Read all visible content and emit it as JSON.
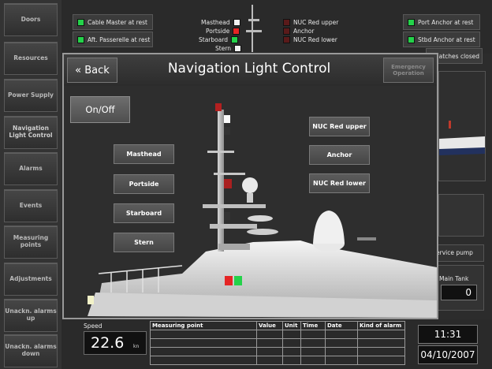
{
  "sidebar": {
    "items": [
      {
        "label": "Doors"
      },
      {
        "label": "Resources"
      },
      {
        "label": "Power Supply"
      },
      {
        "label": "Navigation Light Control"
      },
      {
        "label": "Alarms"
      },
      {
        "label": "Events"
      },
      {
        "label": "Measuring points"
      },
      {
        "label": "Adjustments"
      },
      {
        "label": "Unackn. alarms up"
      },
      {
        "label": "Unackn. alarms down"
      }
    ]
  },
  "status": {
    "cable_master": "Cable Master at rest",
    "aft_passerelle": "Aft. Passerelle at rest",
    "port_anchor": "Port Anchor at rest",
    "stbd_anchor": "Stbd Anchor at rest",
    "hatches": "Hatches closed",
    "lights": [
      {
        "label": "Masthead",
        "color": "#f2f2f2"
      },
      {
        "label": "Portside",
        "color": "#e52525"
      },
      {
        "label": "Starboard",
        "color": "#24d24a"
      },
      {
        "label": "Stern",
        "color": "#f2f2f2"
      }
    ],
    "nuc_lights": [
      {
        "label": "NUC Red upper"
      },
      {
        "label": "Anchor"
      },
      {
        "label": "NUC Red lower"
      }
    ]
  },
  "right_panel": {
    "service_pump": "ervice pump",
    "main_tank_label": "Main Tank",
    "main_tank_value": "0"
  },
  "modal": {
    "back_label": "« Back",
    "title": "Navigation Light Control",
    "emergency_label": "Emergency Operation",
    "onoff_label": "On/Off",
    "left_buttons": [
      "Masthead",
      "Portside",
      "Starboard",
      "Stern"
    ],
    "right_buttons": [
      "NUC Red upper",
      "Anchor",
      "NUC Red lower"
    ]
  },
  "bottom": {
    "speed_label": "Speed",
    "speed_value": "22.6",
    "speed_unit": "kn",
    "table_headers": [
      "Measuring point",
      "Value",
      "Unit",
      "Time",
      "Date",
      "Kind of alarm"
    ],
    "time": "11:31",
    "date": "04/10/2007"
  },
  "colors": {
    "accent_green": "#24d24a",
    "accent_red": "#e52525"
  }
}
